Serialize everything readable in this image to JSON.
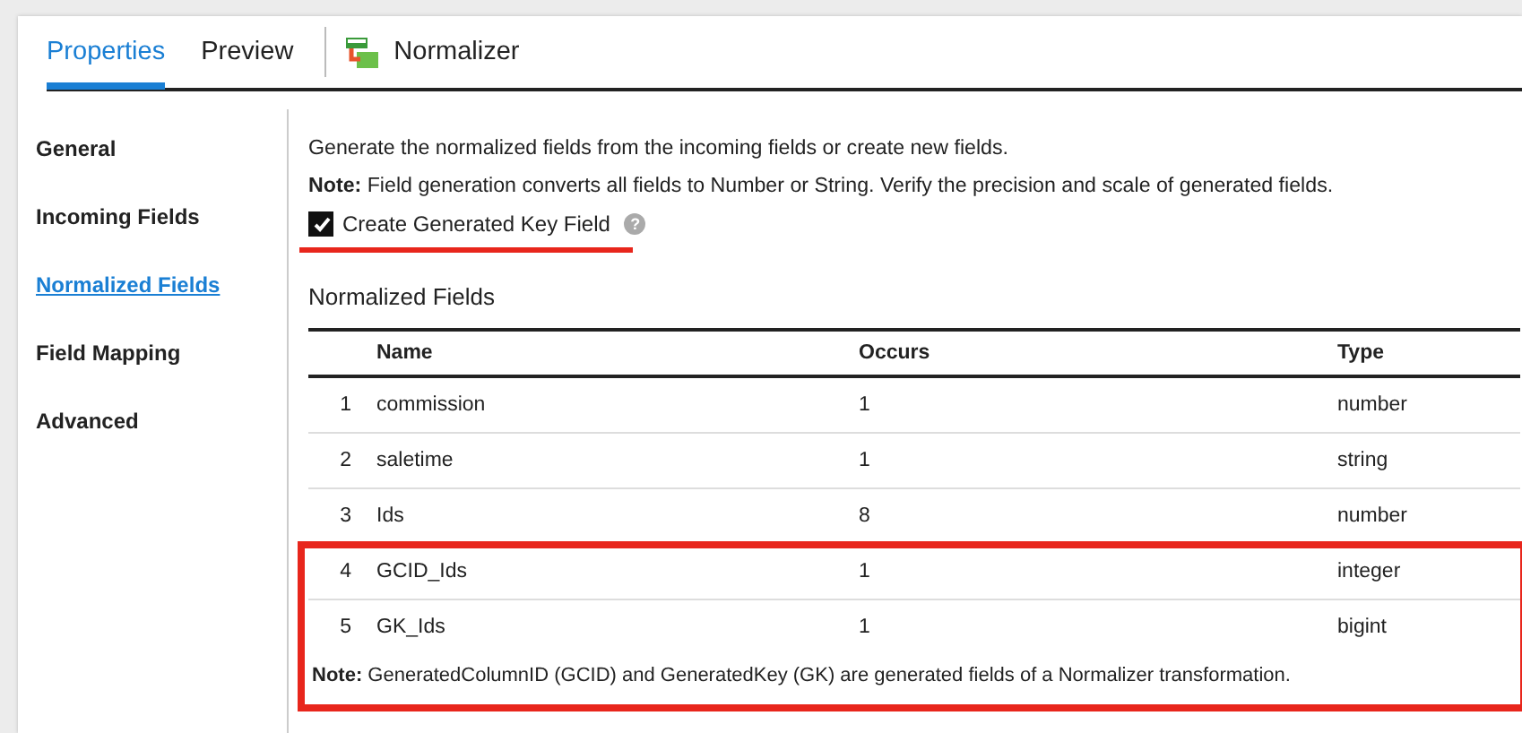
{
  "tabs": [
    {
      "label": "Properties",
      "selected": true
    },
    {
      "label": "Preview",
      "selected": false
    }
  ],
  "header": {
    "title": "Normalizer"
  },
  "sidebar": {
    "items": [
      {
        "label": "General",
        "selected": false
      },
      {
        "label": "Incoming Fields",
        "selected": false
      },
      {
        "label": "Normalized Fields",
        "selected": true
      },
      {
        "label": "Field Mapping",
        "selected": false
      },
      {
        "label": "Advanced",
        "selected": false
      }
    ]
  },
  "description": "Generate the normalized fields from the incoming fields or create new fields.",
  "note": "**Note:** Field generation converts all fields to Number or String. Verify the precision and scale of generated fields.",
  "checkbox": {
    "label": "Create Generated Key Field",
    "checked": true,
    "help": "?"
  },
  "section_title": "Normalized Fields",
  "table": {
    "columns": [
      "Name",
      "Occurs",
      "Type"
    ],
    "rows": [
      {
        "index": "1",
        "name": "commission",
        "occurs": "1",
        "type": "number",
        "highlighted": false
      },
      {
        "index": "2",
        "name": "saletime",
        "occurs": "1",
        "type": "string",
        "highlighted": false
      },
      {
        "index": "3",
        "name": "Ids",
        "occurs": "8",
        "type": "number",
        "highlighted": false
      },
      {
        "index": "4",
        "name": "GCID_Ids",
        "occurs": "1",
        "type": "integer",
        "highlighted": true
      },
      {
        "index": "5",
        "name": "GK_Ids",
        "occurs": "1",
        "type": "bigint",
        "highlighted": true
      }
    ]
  },
  "footnote": "**Note:** GeneratedColumnID (GCID) and GeneratedKey (GK) are generated fields of a Normalizer transformation."
}
